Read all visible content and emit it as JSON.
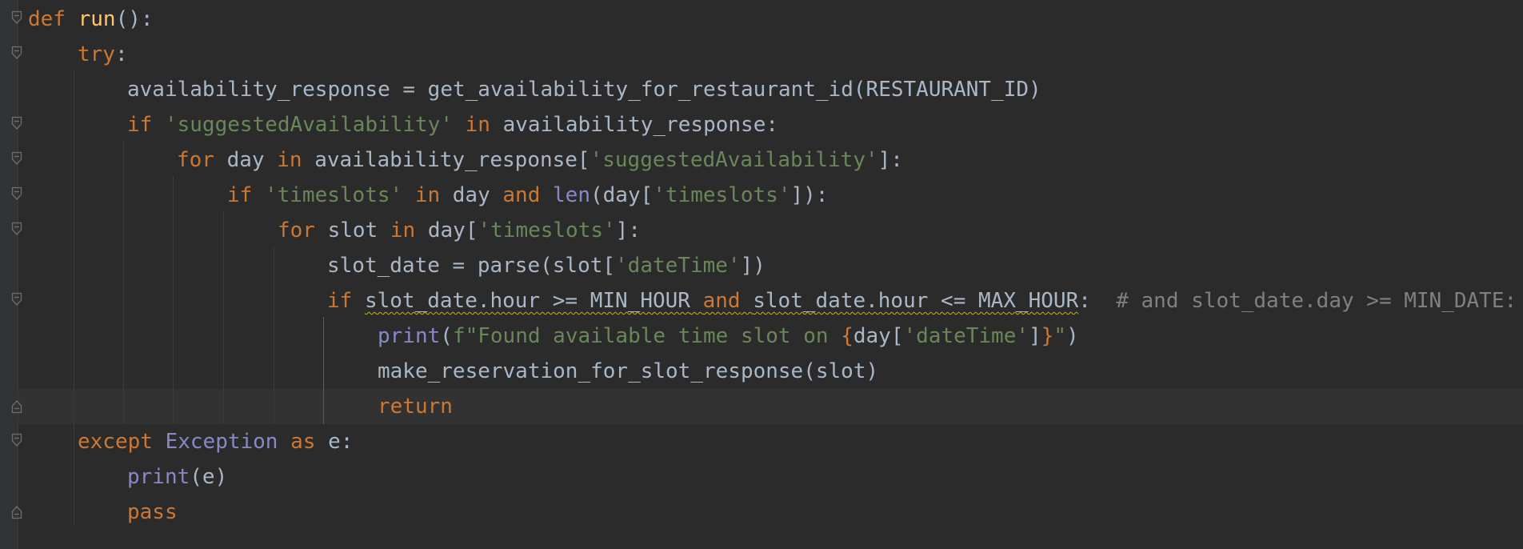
{
  "editor": {
    "language": "python",
    "lines": [
      "def run():",
      "    try:",
      "        availability_response = get_availability_for_restaurant_id(RESTAURANT_ID)",
      "        if 'suggestedAvailability' in availability_response:",
      "            for day in availability_response['suggestedAvailability']:",
      "                if 'timeslots' in day and len(day['timeslots']):",
      "                    for slot in day['timeslots']:",
      "                        slot_date = parse(slot['dateTime'])",
      "                        if slot_date.hour >= MIN_HOUR and slot_date.hour <= MAX_HOUR:  # and slot_date.day >= MIN_DATE:",
      "                            print(f\"Found available time slot on {day['dateTime']}\")",
      "                            make_reservation_for_slot_response(slot)",
      "                            return",
      "    except Exception as e:",
      "        print(e)",
      "        pass"
    ],
    "tokens": {
      "l1": [
        "def",
        " ",
        "run",
        "():"
      ],
      "l2": [
        "try",
        ":"
      ],
      "l3": [
        "availability_response = get_availability_for_restaurant_id(RESTAURANT_ID)"
      ],
      "l4": [
        "if",
        " ",
        "'suggestedAvailability'",
        " ",
        "in",
        " availability_response:"
      ],
      "l5": [
        "for",
        " day ",
        "in",
        " availability_response[",
        "'suggestedAvailability'",
        "]:"
      ],
      "l6": [
        "if",
        " ",
        "'timeslots'",
        " ",
        "in",
        " day ",
        "and",
        " ",
        "len",
        "(day[",
        "'timeslots'",
        "]):"
      ],
      "l7": [
        "for",
        " slot ",
        "in",
        " day[",
        "'timeslots'",
        "]:"
      ],
      "l8": [
        "slot_date = parse(slot[",
        "'dateTime'",
        "])"
      ],
      "l9": [
        "if",
        " ",
        "slot_date.hour >= MIN_HOUR",
        " ",
        "and",
        " ",
        "slot_date.hour <= MAX_HOUR",
        ":  ",
        "# and slot_date.day >= MIN_DATE:"
      ],
      "l10": [
        "print",
        "(",
        "f\"Found available time slot on ",
        "{",
        "day[",
        "'dateTime'",
        "]",
        "}",
        "\"",
        ")"
      ],
      "l11": [
        "make_reservation_for_slot_response(slot)"
      ],
      "l12": [
        "return"
      ],
      "l13": [
        "except",
        " ",
        "Exception",
        " ",
        "as",
        " e:"
      ],
      "l14": [
        "print",
        "(e)"
      ],
      "l15": [
        "pass"
      ]
    },
    "caret_line": 12,
    "colors": {
      "background": "#2b2b2b",
      "keyword": "#cc7832",
      "function_def": "#ffc66d",
      "string": "#6a8759",
      "builtin": "#8888c6",
      "comment": "#808080",
      "identifier": "#a9b7c6",
      "weak_warning": "#bbb529"
    },
    "gutter_icons": [
      "fold-open-icon",
      "fold-close-icon"
    ]
  }
}
